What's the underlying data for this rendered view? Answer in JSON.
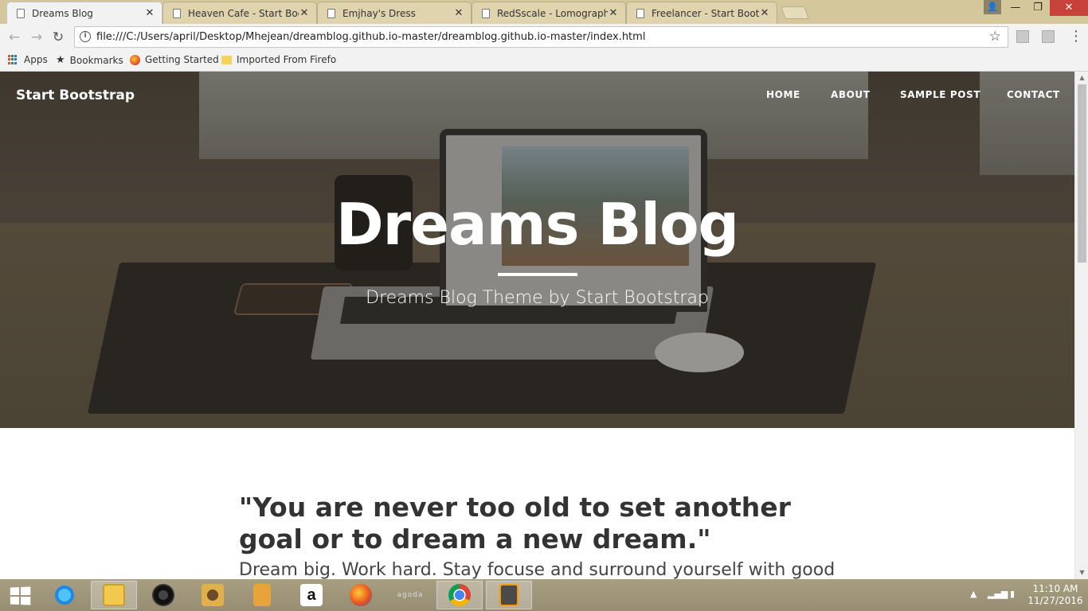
{
  "browser": {
    "tabs": [
      {
        "title": "Dreams Blog",
        "close": "✕",
        "active": true
      },
      {
        "title": "Heaven Cafe - Start Boot",
        "close": "✕",
        "active": false
      },
      {
        "title": "Emjhay's Dress",
        "close": "✕",
        "active": false
      },
      {
        "title": "RedSscale - Lomography",
        "close": "✕",
        "active": false
      },
      {
        "title": "Freelancer - Start Bootstr",
        "close": "✕",
        "active": false
      }
    ],
    "url": "file:///C:/Users/april/Desktop/Mhejean/dreamblog.github.io-master/dreamblog.github.io-master/index.html",
    "bookmarks": {
      "apps": "Apps",
      "bookmarks": "Bookmarks",
      "getting_started": "Getting Started",
      "imported": "Imported From Firefo"
    },
    "window": {
      "user": "👤",
      "minimize": "—",
      "maximize": "❐",
      "close": "✕"
    }
  },
  "page": {
    "brand": "Start Bootstrap",
    "nav": [
      "HOME",
      "ABOUT",
      "SAMPLE POST",
      "CONTACT"
    ],
    "hero": {
      "title": "Dreams Blog",
      "subtitle": "Dreams Blog Theme by Start Bootstrap"
    },
    "post": {
      "title": "\"You are never too old to set another goal or to dream a new dream.\"",
      "subtitle": "Dream big. Work hard. Stay focuse and surround yourself with good"
    }
  },
  "taskbar": {
    "apps": [
      "internet-explorer",
      "file-explorer",
      "media-player",
      "settings-app",
      "notes-app",
      "amazon",
      "firefox",
      "agoda",
      "chrome",
      "sublime-text"
    ],
    "agoda_label": "agoda",
    "clock": {
      "time": "11:10 AM",
      "date": "11/27/2016"
    }
  },
  "colors": {
    "tab_strip": "#d4c79c",
    "heading_text": "#333333",
    "hero_text": "#ffffff"
  }
}
